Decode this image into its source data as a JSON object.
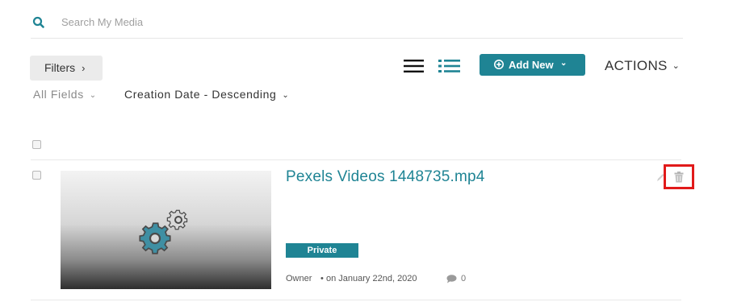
{
  "search": {
    "placeholder": "Search My Media",
    "value": ""
  },
  "toolbar": {
    "filters_label": "Filters",
    "filters_chevron": "›",
    "add_new_label": "Add New",
    "add_new_caret": "⌄",
    "actions_label": "ACTIONS",
    "actions_caret": "⌄"
  },
  "filters": {
    "field_label": "All Fields",
    "sort_label": "Creation Date - Descending",
    "caret": "⌄"
  },
  "media": [
    {
      "title": "Pexels Videos 1448735.mp4",
      "privacy": "Private",
      "owner": "Owner",
      "bullet": "•",
      "date": "on January 22nd, 2020",
      "comments": "0"
    }
  ],
  "colors": {
    "accent": "#1f8494",
    "highlight": "#e11a1a"
  },
  "icons": [
    "search-icon",
    "list-view-icon",
    "detailed-view-icon",
    "plus-circle-icon",
    "gears-icon",
    "pencil-icon",
    "trash-icon",
    "comment-icon"
  ]
}
